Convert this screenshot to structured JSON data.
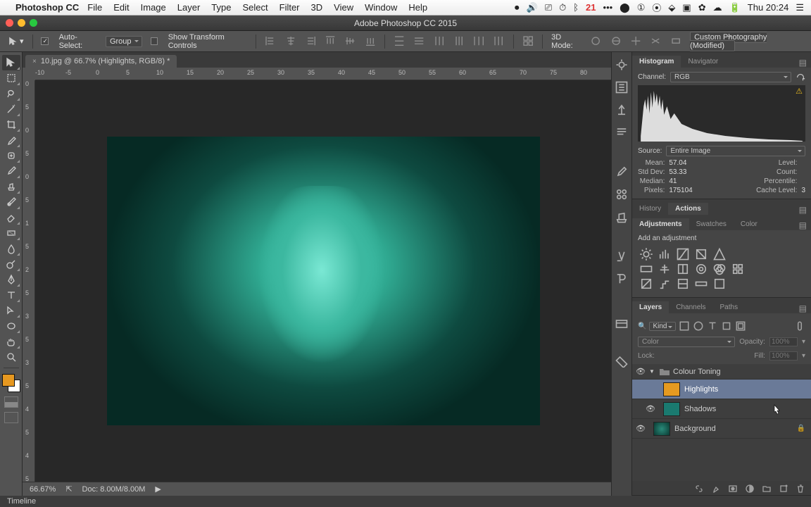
{
  "menubar": {
    "app_name": "Photoshop CC",
    "items": [
      "File",
      "Edit",
      "Image",
      "Layer",
      "Type",
      "Select",
      "Filter",
      "3D",
      "View",
      "Window",
      "Help"
    ],
    "clock": "Thu 20:24"
  },
  "window": {
    "title": "Adobe Photoshop CC 2015"
  },
  "options": {
    "auto_select_label": "Auto-Select:",
    "auto_select_mode": "Group",
    "show_transform_label": "Show Transform Controls",
    "mode3d_label": "3D Mode:",
    "preset": "Custom Photography (Modified)"
  },
  "document": {
    "tab_title": "10.jpg @ 66.7% (Highlights, RGB/8) *",
    "zoom": "66.67%",
    "doc_size": "Doc: 8.00M/8.00M",
    "ruler_h": [
      "-10",
      "-5",
      "0",
      "5",
      "10",
      "15",
      "20",
      "25",
      "30",
      "35",
      "40",
      "45",
      "50",
      "55",
      "60",
      "65",
      "70",
      "75",
      "80"
    ],
    "ruler_v": [
      "0",
      "5",
      "0",
      "5",
      "0",
      "5",
      "1",
      "5",
      "2",
      "5",
      "3",
      "5",
      "3",
      "5",
      "4",
      "5",
      "4",
      "5"
    ]
  },
  "swatches": {
    "foreground": "#e59a20",
    "background": "#ffffff"
  },
  "timeline": {
    "label": "Timeline"
  },
  "panels": {
    "histogram": {
      "tabs": [
        "Histogram",
        "Navigator"
      ],
      "channel_label": "Channel:",
      "channel": "RGB",
      "source_label": "Source:",
      "source": "Entire Image",
      "stats": {
        "mean_label": "Mean:",
        "mean": "57.04",
        "stddev_label": "Std Dev:",
        "stddev": "53.33",
        "median_label": "Median:",
        "median": "41",
        "pixels_label": "Pixels:",
        "pixels": "175104",
        "level_label": "Level:",
        "level": "",
        "count_label": "Count:",
        "count": "",
        "percentile_label": "Percentile:",
        "percentile": "",
        "cache_label": "Cache Level:",
        "cache": "3"
      }
    },
    "history_actions": {
      "tabs": [
        "History",
        "Actions"
      ]
    },
    "adjustments": {
      "tabs": [
        "Adjustments",
        "Swatches",
        "Color"
      ],
      "hint": "Add an adjustment"
    },
    "layers": {
      "tabs": [
        "Layers",
        "Channels",
        "Paths"
      ],
      "filter_kind_label": "Kind",
      "blend_mode": "Color",
      "opacity_label": "Opacity:",
      "opacity": "100%",
      "lock_label": "Lock:",
      "fill_label": "Fill:",
      "fill": "100%",
      "items": {
        "group_name": "Colour Toning",
        "highlights": {
          "name": "Highlights",
          "color": "#e59a20"
        },
        "shadows": {
          "name": "Shadows",
          "color": "#1a7a70"
        },
        "background": {
          "name": "Background"
        }
      }
    }
  }
}
